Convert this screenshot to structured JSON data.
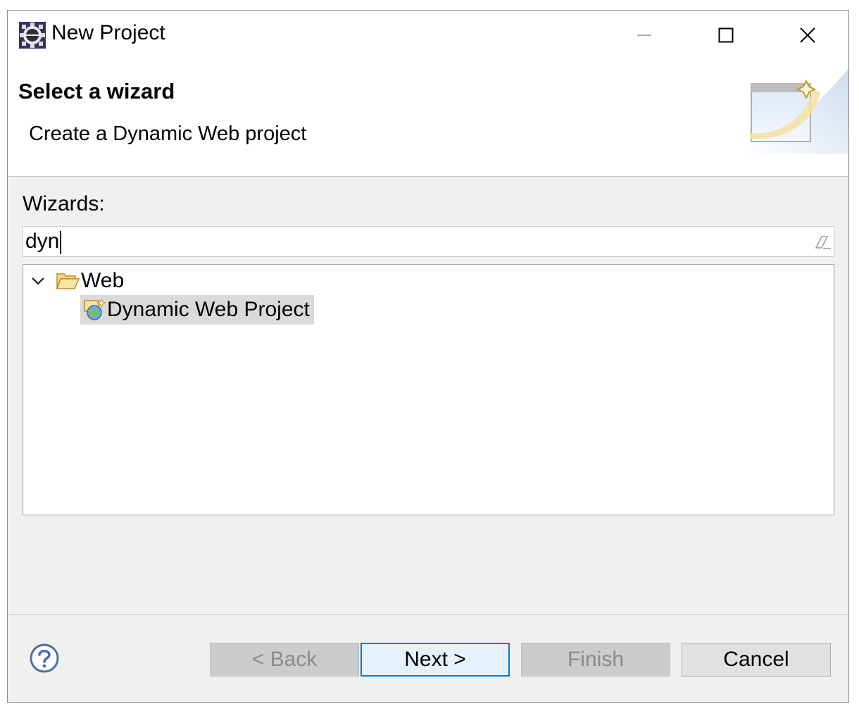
{
  "window": {
    "title": "New Project",
    "app_icon": "eclipse-icon",
    "controls": [
      "minimize-icon",
      "maximize-icon",
      "close-icon"
    ]
  },
  "header": {
    "title": "Select a wizard",
    "description": "Create a Dynamic Web project",
    "banner_icon": "new-wizard-banner-icon"
  },
  "wizards": {
    "label": "Wizards:",
    "filter_value": "dyn",
    "clear_icon": "eraser-icon",
    "tree": [
      {
        "label": "Web",
        "icon": "open-folder-icon",
        "expanded": true,
        "children": [
          {
            "label": "Dynamic Web Project",
            "icon": "dynamic-web-project-icon",
            "selected": true
          }
        ]
      }
    ]
  },
  "footer": {
    "help_icon": "help-icon",
    "buttons": {
      "back": "< Back",
      "next": "Next >",
      "finish": "Finish",
      "cancel": "Cancel"
    }
  },
  "colors": {
    "selection": "#dadada",
    "default_button_border": "#0078d7",
    "disabled_text": "#8a8a8a",
    "dialog_background": "#f0f0f0"
  }
}
